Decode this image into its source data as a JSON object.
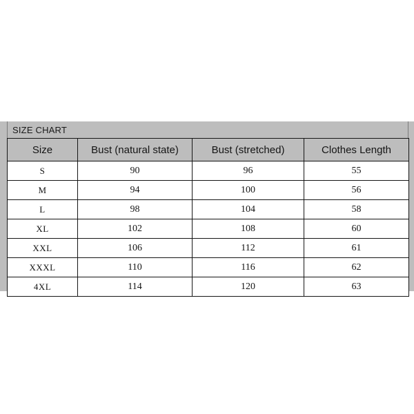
{
  "panel": {
    "title": "SIZE CHART",
    "background_color": "#bdbdbd",
    "border_color": "#151515"
  },
  "chart_data": {
    "type": "table",
    "title": "SIZE CHART",
    "columns": [
      "Size",
      "Bust (natural state)",
      "Bust (stretched)",
      "Clothes Length"
    ],
    "rows": [
      [
        "S",
        "90",
        "96",
        "55"
      ],
      [
        "M",
        "94",
        "100",
        "56"
      ],
      [
        "L",
        "98",
        "104",
        "58"
      ],
      [
        "XL",
        "102",
        "108",
        "60"
      ],
      [
        "XXL",
        "106",
        "112",
        "61"
      ],
      [
        "XXXL",
        "110",
        "116",
        "62"
      ],
      [
        "4XL",
        "114",
        "120",
        "63"
      ]
    ]
  }
}
